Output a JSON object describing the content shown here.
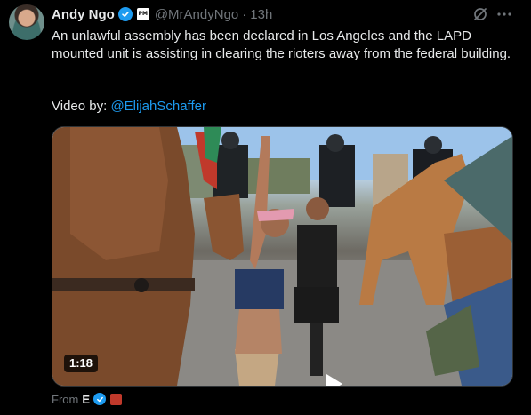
{
  "author": {
    "display_name": "Andy Ngo",
    "handle": "@MrAndyNgo",
    "separator": "·",
    "time": "13h",
    "affiliation_badge_text": "PM"
  },
  "tweet": {
    "text": "An unlawful assembly has been declared in Los Angeles and the LAPD mounted unit is assisting in clearing the rioters away from the federal building.",
    "credit_prefix": "Video by: ",
    "credit_mention": "@ElijahSchaffer"
  },
  "media": {
    "duration": "1:18"
  },
  "footer": {
    "from_label": "From",
    "from_name": "E"
  },
  "icons": {
    "verified": "verified-badge-icon",
    "grok": "grok-icon",
    "more": "more-options-icon",
    "play": "play-icon"
  },
  "colors": {
    "background": "#000000",
    "text": "#e7e9ea",
    "muted": "#71767b",
    "accent": "#1d9bf0"
  }
}
